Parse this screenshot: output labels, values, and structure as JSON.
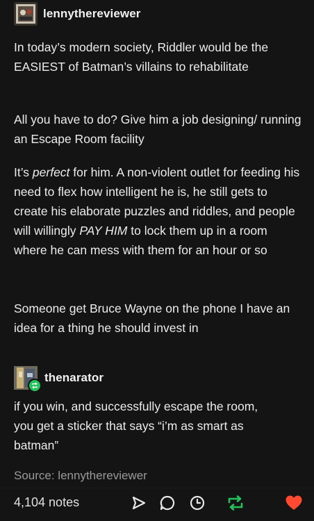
{
  "post": {
    "first": {
      "username": "lennythereviewer",
      "paragraphs": [
        {
          "text": "In today’s modern society, Riddler would be the EASIEST of Batman’s villains to rehabilitate"
        },
        {
          "text": "All you have to do? Give him a job designing/ running an Escape Room facility"
        }
      ],
      "p3": {
        "part1": "It’s ",
        "em1": "perfect",
        "part2": " for him. A non-violent outlet for feeding his need to flex how intelligent he is, he still gets to create his elaborate puzzles and riddles, and people will willingly ",
        "em2": "PAY HIM",
        "part3": " to lock them up in a room where he can mess with them for an hour or so"
      },
      "p4": "Someone get Bruce Wayne on the phone I have an idea for a thing he should invest in"
    },
    "second": {
      "username": "thenarator",
      "text": "if you win, and successfully escape the room, you get a sticker that says “i’m as smart as batman”"
    },
    "source": "Source: lennythereviewer",
    "footer": {
      "notes": "4,104 notes",
      "icons": [
        "share-icon",
        "reply-icon",
        "history-icon",
        "reblog-icon",
        "like-icon"
      ]
    },
    "colors": {
      "background": "#141414",
      "text": "#ececec",
      "muted": "#9a9a9a",
      "reblog": "#25c25c",
      "like": "#ff4930"
    }
  }
}
